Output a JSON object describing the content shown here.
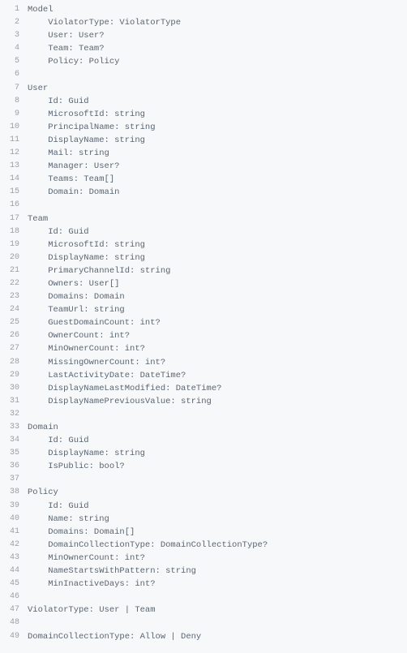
{
  "code": {
    "lines": [
      {
        "num": "1",
        "text": "Model"
      },
      {
        "num": "2",
        "text": "    ViolatorType: ViolatorType"
      },
      {
        "num": "3",
        "text": "    User: User?"
      },
      {
        "num": "4",
        "text": "    Team: Team?"
      },
      {
        "num": "5",
        "text": "    Policy: Policy"
      },
      {
        "num": "6",
        "text": ""
      },
      {
        "num": "7",
        "text": "User"
      },
      {
        "num": "8",
        "text": "    Id: Guid"
      },
      {
        "num": "9",
        "text": "    MicrosoftId: string"
      },
      {
        "num": "10",
        "text": "    PrincipalName: string"
      },
      {
        "num": "11",
        "text": "    DisplayName: string"
      },
      {
        "num": "12",
        "text": "    Mail: string"
      },
      {
        "num": "13",
        "text": "    Manager: User?"
      },
      {
        "num": "14",
        "text": "    Teams: Team[]"
      },
      {
        "num": "15",
        "text": "    Domain: Domain"
      },
      {
        "num": "16",
        "text": ""
      },
      {
        "num": "17",
        "text": "Team"
      },
      {
        "num": "18",
        "text": "    Id: Guid"
      },
      {
        "num": "19",
        "text": "    MicrosoftId: string"
      },
      {
        "num": "20",
        "text": "    DisplayName: string"
      },
      {
        "num": "21",
        "text": "    PrimaryChannelId: string"
      },
      {
        "num": "22",
        "text": "    Owners: User[]"
      },
      {
        "num": "23",
        "text": "    Domains: Domain"
      },
      {
        "num": "24",
        "text": "    TeamUrl: string"
      },
      {
        "num": "25",
        "text": "    GuestDomainCount: int?"
      },
      {
        "num": "26",
        "text": "    OwnerCount: int?"
      },
      {
        "num": "27",
        "text": "    MinOwnerCount: int?"
      },
      {
        "num": "28",
        "text": "    MissingOwnerCount: int?"
      },
      {
        "num": "29",
        "text": "    LastActivityDate: DateTime?"
      },
      {
        "num": "30",
        "text": "    DisplayNameLastModified: DateTime?"
      },
      {
        "num": "31",
        "text": "    DisplayNamePreviousValue: string"
      },
      {
        "num": "32",
        "text": ""
      },
      {
        "num": "33",
        "text": "Domain"
      },
      {
        "num": "34",
        "text": "    Id: Guid"
      },
      {
        "num": "35",
        "text": "    DisplayName: string"
      },
      {
        "num": "36",
        "text": "    IsPublic: bool?"
      },
      {
        "num": "37",
        "text": ""
      },
      {
        "num": "38",
        "text": "Policy"
      },
      {
        "num": "39",
        "text": "    Id: Guid"
      },
      {
        "num": "40",
        "text": "    Name: string"
      },
      {
        "num": "41",
        "text": "    Domains: Domain[]"
      },
      {
        "num": "42",
        "text": "    DomainCollectionType: DomainCollectionType?"
      },
      {
        "num": "43",
        "text": "    MinOwnerCount: int?"
      },
      {
        "num": "44",
        "text": "    NameStartsWithPattern: string"
      },
      {
        "num": "45",
        "text": "    MinInactiveDays: int?"
      },
      {
        "num": "46",
        "text": ""
      },
      {
        "num": "47",
        "text": "ViolatorType: User | Team"
      },
      {
        "num": "48",
        "text": ""
      },
      {
        "num": "49",
        "text": "DomainCollectionType: Allow | Deny"
      }
    ]
  }
}
